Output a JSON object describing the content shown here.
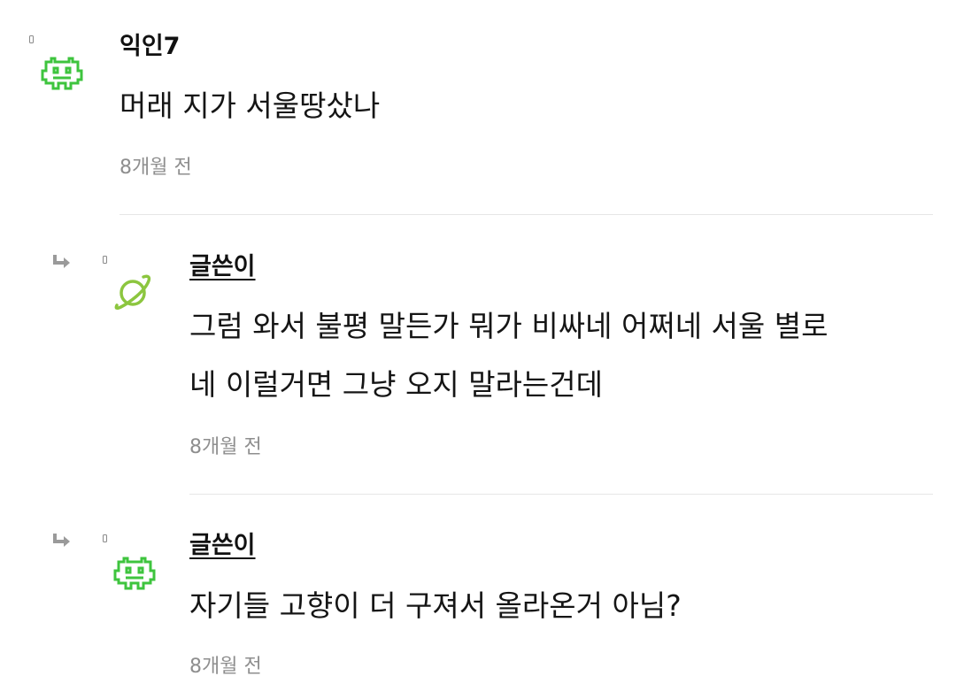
{
  "comments": [
    {
      "author": "익인7",
      "body": [
        "머래 지가 서울땅샀나"
      ],
      "time": "8개월 전",
      "avatar": "pixel-invader-icon",
      "avatar_color": "#3ec43e",
      "is_reply": false,
      "is_op": false
    },
    {
      "author": "글쓴이",
      "body": [
        "그럼 와서 불평 말든가 뭐가 비싸네 어쩌네 서울 별로",
        "네 이럴거면 그냥 오지 말라는건데"
      ],
      "time": "8개월 전",
      "avatar": "planet-icon",
      "avatar_color": "#8cc63f",
      "is_reply": true,
      "is_op": true
    },
    {
      "author": "글쓴이",
      "body": [
        "자기들 고향이 더 구져서 올라온거 아님?"
      ],
      "time": "8개월 전",
      "avatar": "pixel-invader-icon",
      "avatar_color": "#3ec43e",
      "is_reply": true,
      "is_op": true
    }
  ]
}
